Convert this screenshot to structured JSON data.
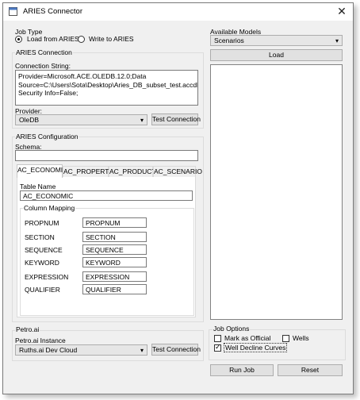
{
  "window": {
    "title": "ARIES Connector",
    "close_glyph": "✕"
  },
  "job_type": {
    "title": "Job Type",
    "options": [
      {
        "label": "Load from ARIES",
        "selected": true
      },
      {
        "label": "Write to ARIES",
        "selected": false
      }
    ]
  },
  "aries_connection": {
    "title": "ARIES Connection",
    "connection_label": "Connection String:",
    "connection_string": "Provider=Microsoft.ACE.OLEDB.12.0;Data Source=C:\\Users\\Sota\\Desktop\\Aries_DB_subset_test.accdb;Persist Security Info=False;",
    "provider_label": "Provider:",
    "provider_value": "OleDB",
    "test_button": "Test Connection"
  },
  "aries_config": {
    "title": "ARIES Configuration",
    "schema_label": "Schema:",
    "schema_value": "",
    "tabs": [
      "AC_ECONOMIC",
      "AC_PROPERTY",
      "AC_PRODUCT",
      "AC_SCENARIO"
    ],
    "active_tab": 0,
    "table_name_label": "Table Name",
    "table_name_value": "AC_ECONOMIC",
    "column_mapping_title": "Column Mapping",
    "mappings": [
      {
        "label": "PROPNUM",
        "value": "PROPNUM"
      },
      {
        "label": "SECTION",
        "value": "SECTION"
      },
      {
        "label": "SEQUENCE",
        "value": "SEQUENCE"
      },
      {
        "label": "KEYWORD",
        "value": "KEYWORD"
      },
      {
        "label": "EXPRESSION",
        "value": "EXPRESSION"
      },
      {
        "label": "QUALIFIER",
        "value": "QUALIFIER"
      }
    ]
  },
  "models": {
    "label": "Available Models",
    "selected": "Scenarios",
    "load_button": "Load"
  },
  "petro": {
    "title": "Petro.ai",
    "instance_label": "Petro.ai Instance",
    "instance_value": "Ruths.ai Dev Cloud",
    "test_button": "Test Connection"
  },
  "job_options": {
    "title": "Job Options",
    "mark_official": {
      "label": "Mark as Official",
      "checked": false
    },
    "wells": {
      "label": "Wells",
      "checked": false
    },
    "well_decline": {
      "label": "Well Decline Curves",
      "checked": true
    }
  },
  "actions": {
    "run": "Run Job",
    "reset": "Reset"
  },
  "icons": {
    "dropdown": "▾"
  }
}
